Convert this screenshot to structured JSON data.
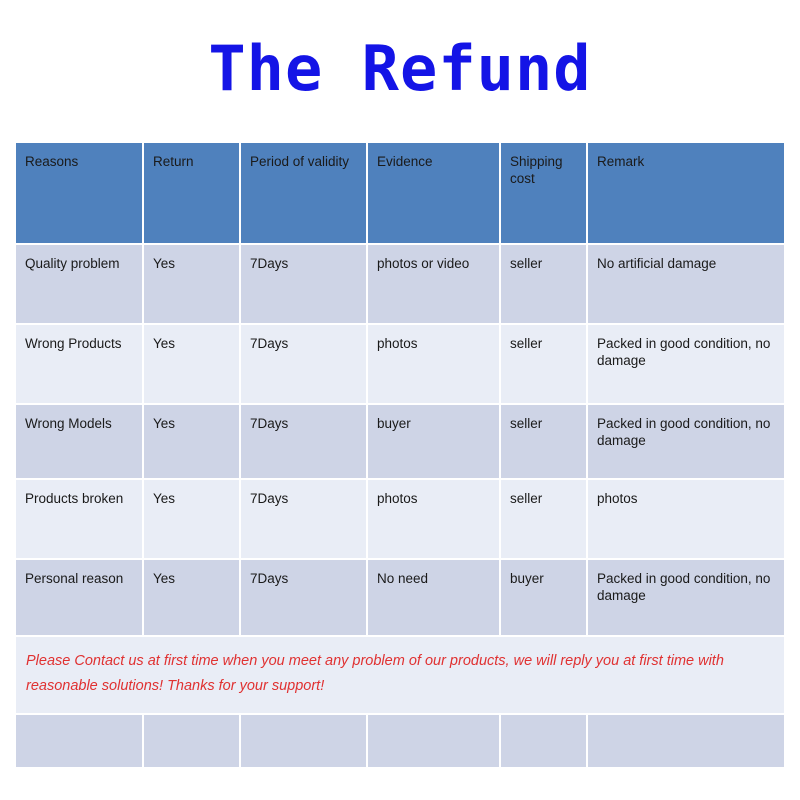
{
  "title": "The Refund",
  "colors": {
    "title": "#1414e6",
    "header_bg": "#4f81bd",
    "header_text": "#ffffff",
    "row_dark": "#ced4e6",
    "row_light": "#e9edf6",
    "note_text": "#e03131",
    "page_bg": "#ffffff"
  },
  "table": {
    "headers": [
      "Reasons",
      "Return",
      "Period of validity",
      "Evidence",
      "Shipping cost",
      "Remark"
    ],
    "rows": [
      {
        "reason": "Quality problem",
        "return": "Yes",
        "period": "7Days",
        "evidence": "photos or video",
        "shipping_cost": "seller",
        "remark": "No artificial damage"
      },
      {
        "reason": "Wrong Products",
        "return": "Yes",
        "period": "7Days",
        "evidence": "photos",
        "shipping_cost": "seller",
        "remark": "Packed in good condition, no damage"
      },
      {
        "reason": "Wrong Models",
        "return": "Yes",
        "period": "7Days",
        "evidence": "buyer",
        "shipping_cost": "seller",
        "remark": "Packed in good condition, no damage"
      },
      {
        "reason": "Products broken",
        "return": "Yes",
        "period": "7Days",
        "evidence": "photos",
        "shipping_cost": "seller",
        "remark": "photos"
      },
      {
        "reason": "Personal reason",
        "return": "Yes",
        "period": "7Days",
        "evidence": "No need",
        "shipping_cost": "buyer",
        "remark": "Packed in good condition, no damage"
      }
    ],
    "note": "Please Contact us at first time when you meet any problem of our products, we will reply you at first time with reasonable solutions! Thanks for your support!",
    "blank_row_cells": [
      "",
      "",
      "",
      "",
      "",
      ""
    ]
  }
}
